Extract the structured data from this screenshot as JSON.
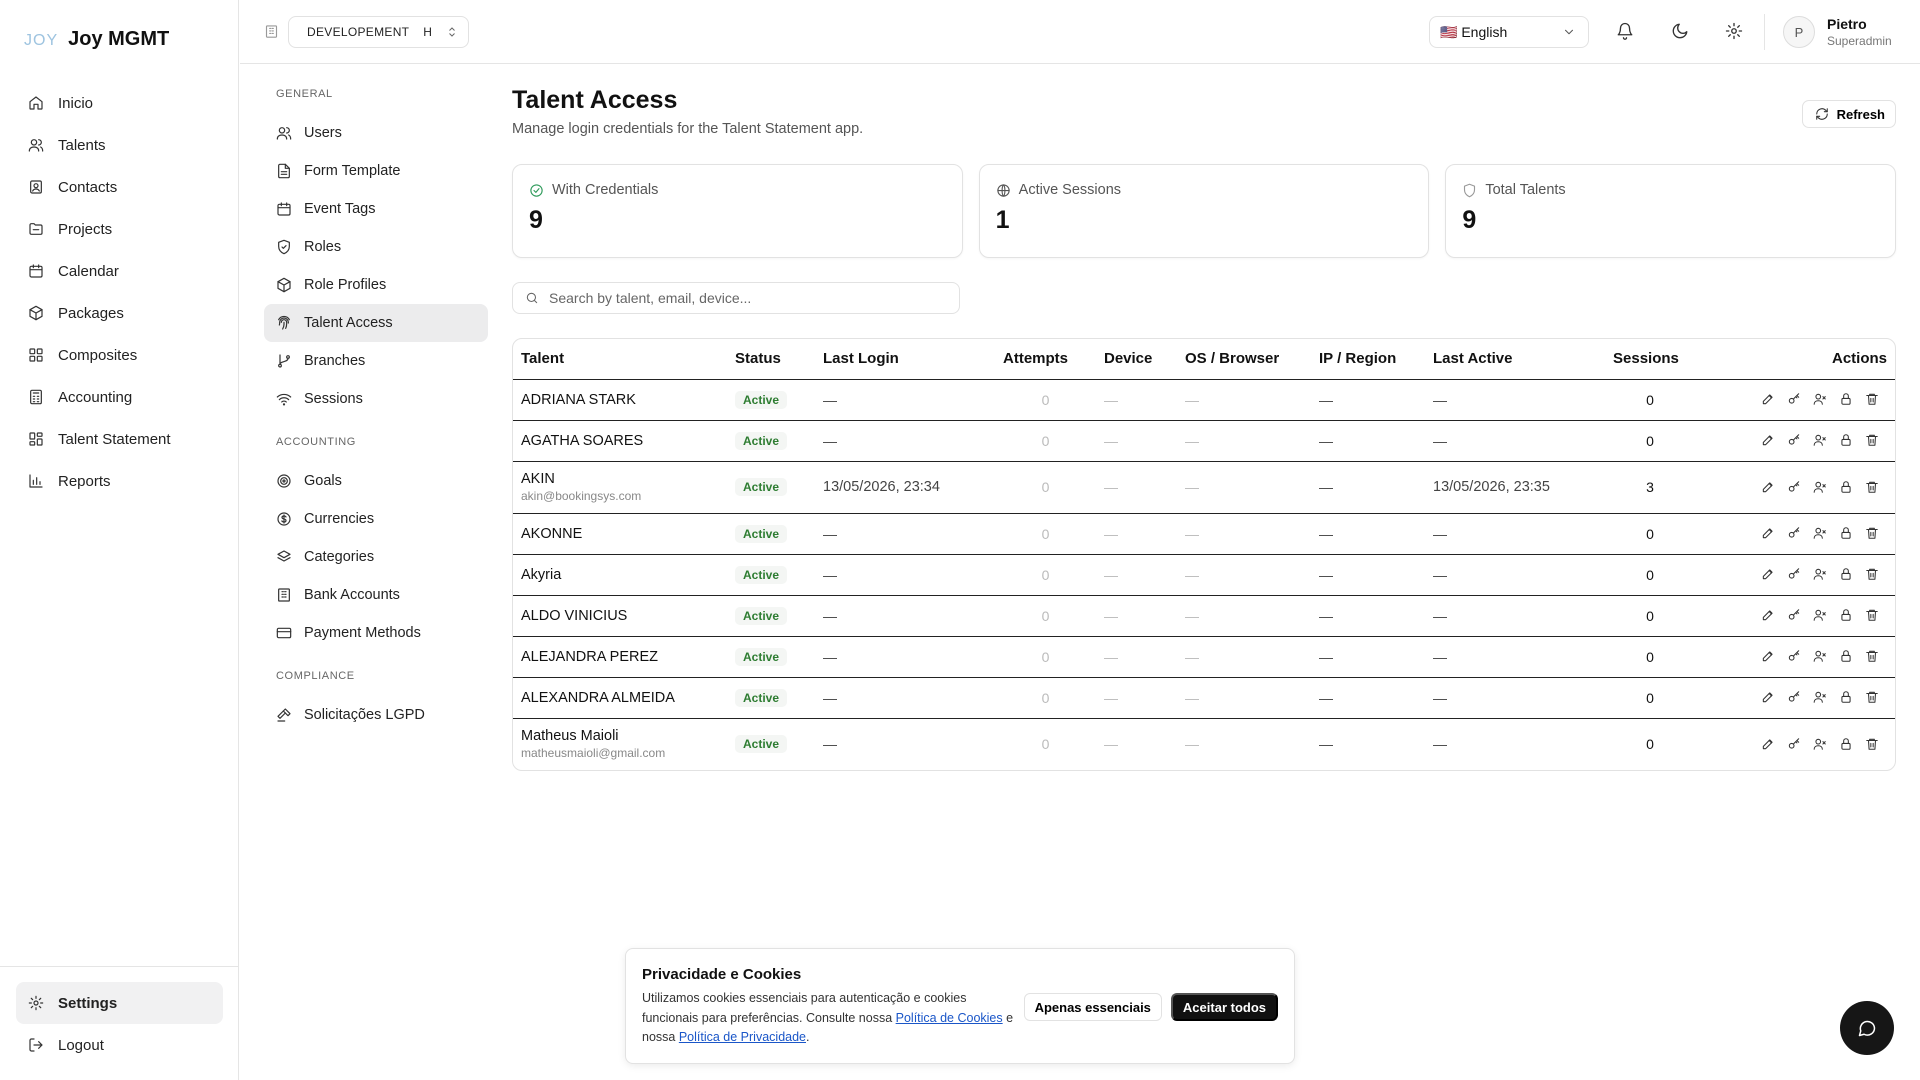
{
  "app": {
    "logo_mark": "JOY",
    "logo_text": "Joy MGMT"
  },
  "sidebar": {
    "items": [
      {
        "label": "Inicio",
        "icon": "home-icon"
      },
      {
        "label": "Talents",
        "icon": "users-icon"
      },
      {
        "label": "Contacts",
        "icon": "contact-icon"
      },
      {
        "label": "Projects",
        "icon": "folder-icon"
      },
      {
        "label": "Calendar",
        "icon": "calendar-icon"
      },
      {
        "label": "Packages",
        "icon": "package-icon"
      },
      {
        "label": "Composites",
        "icon": "grid-icon"
      },
      {
        "label": "Accounting",
        "icon": "calculator-icon"
      },
      {
        "label": "Talent Statement",
        "icon": "statement-icon"
      },
      {
        "label": "Reports",
        "icon": "bar-chart-icon"
      }
    ],
    "bottom": {
      "settings": "Settings",
      "logout": "Logout"
    }
  },
  "topbar": {
    "env": "DEVELOPEMENT",
    "env_badge": "H",
    "language": "🇺🇸 English",
    "user_initial": "P",
    "user_name": "Pietro",
    "user_role": "Superadmin"
  },
  "subnav": {
    "general_title": "GENERAL",
    "general": [
      "Users",
      "Form Template",
      "Event Tags",
      "Roles",
      "Role Profiles",
      "Talent Access",
      "Branches",
      "Sessions"
    ],
    "accounting_title": "ACCOUNTING",
    "accounting": [
      "Goals",
      "Currencies",
      "Categories",
      "Bank Accounts",
      "Payment Methods"
    ],
    "compliance_title": "COMPLIANCE",
    "compliance": [
      "Solicitações LGPD"
    ]
  },
  "page": {
    "title": "Talent Access",
    "description": "Manage login credentials for the Talent Statement app.",
    "refresh": "Refresh"
  },
  "stats": {
    "credentials_label": "With Credentials",
    "credentials_value": "9",
    "sessions_label": "Active Sessions",
    "sessions_value": "1",
    "talents_label": "Total Talents",
    "talents_value": "9"
  },
  "search": {
    "placeholder": "Search by talent, email, device..."
  },
  "table": {
    "headers": [
      "Talent",
      "Status",
      "Last Login",
      "Attempts",
      "Device",
      "OS / Browser",
      "IP / Region",
      "Last Active",
      "Sessions",
      "Actions"
    ],
    "rows": [
      {
        "name": "ADRIANA STARK",
        "email": "",
        "status": "Active",
        "last_login": "—",
        "attempts": "0",
        "device": "—",
        "os": "—",
        "ip": "—",
        "last_active": "—",
        "sessions": "0"
      },
      {
        "name": "AGATHA SOARES",
        "email": "",
        "status": "Active",
        "last_login": "—",
        "attempts": "0",
        "device": "—",
        "os": "—",
        "ip": "—",
        "last_active": "—",
        "sessions": "0"
      },
      {
        "name": "AKIN",
        "email": "akin@bookingsys.com",
        "status": "Active",
        "last_login": "13/05/2026, 23:34",
        "attempts": "0",
        "device": "—",
        "os": "—",
        "ip": "—",
        "last_active": "13/05/2026, 23:35",
        "sessions": "3"
      },
      {
        "name": "AKONNE",
        "email": "",
        "status": "Active",
        "last_login": "—",
        "attempts": "0",
        "device": "—",
        "os": "—",
        "ip": "—",
        "last_active": "—",
        "sessions": "0"
      },
      {
        "name": "Akyria",
        "email": "",
        "status": "Active",
        "last_login": "—",
        "attempts": "0",
        "device": "—",
        "os": "—",
        "ip": "—",
        "last_active": "—",
        "sessions": "0"
      },
      {
        "name": "ALDO VINICIUS",
        "email": "",
        "status": "Active",
        "last_login": "—",
        "attempts": "0",
        "device": "—",
        "os": "—",
        "ip": "—",
        "last_active": "—",
        "sessions": "0"
      },
      {
        "name": "ALEJANDRA PEREZ",
        "email": "",
        "status": "Active",
        "last_login": "—",
        "attempts": "0",
        "device": "—",
        "os": "—",
        "ip": "—",
        "last_active": "—",
        "sessions": "0"
      },
      {
        "name": "ALEXANDRA ALMEIDA",
        "email": "",
        "status": "Active",
        "last_login": "—",
        "attempts": "0",
        "device": "—",
        "os": "—",
        "ip": "—",
        "last_active": "—",
        "sessions": "0"
      },
      {
        "name": "Matheus Maioli",
        "email": "matheusmaioli@gmail.com",
        "status": "Active",
        "last_login": "—",
        "attempts": "0",
        "device": "—",
        "os": "—",
        "ip": "—",
        "last_active": "—",
        "sessions": "0"
      }
    ],
    "action_icons": [
      "edit-icon",
      "key-icon",
      "user-x-icon",
      "lock-icon",
      "trash-icon"
    ]
  },
  "cookie": {
    "title": "Privacidade e Cookies",
    "text_1": "Utilizamos cookies essenciais para autenticação e cookies funcionais para preferências. Consulte nossa ",
    "link_1": "Política de Cookies",
    "text_2": " e nossa ",
    "link_2": "Política de Privacidade",
    "text_3": ".",
    "essential": "Apenas essenciais",
    "accept": "Aceitar todos"
  },
  "colors": {
    "status_green": "#2e7d32",
    "link_blue": "#1a56c8",
    "dark_button": "#111111"
  }
}
